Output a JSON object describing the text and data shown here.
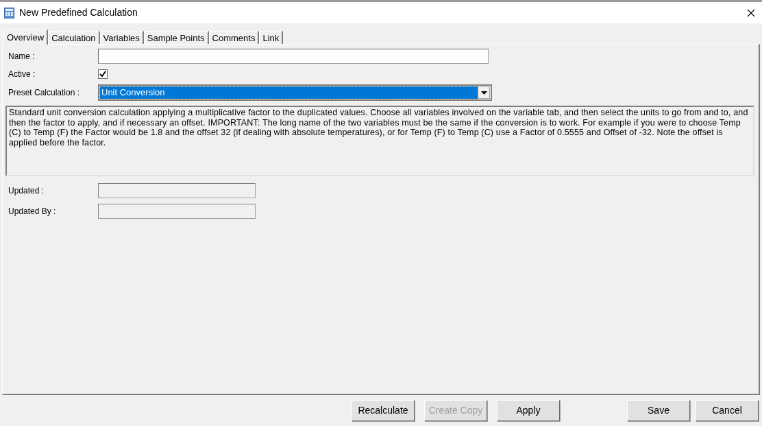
{
  "window": {
    "title": "New Predefined Calculation"
  },
  "tabs": [
    {
      "label": "Overview",
      "selected": true
    },
    {
      "label": "Calculation",
      "selected": false
    },
    {
      "label": "Variables",
      "selected": false
    },
    {
      "label": "Sample Points",
      "selected": false
    },
    {
      "label": "Comments",
      "selected": false
    },
    {
      "label": "Link",
      "selected": false
    }
  ],
  "form": {
    "name": {
      "label": "Name :"
    },
    "active": {
      "label": "Active :",
      "checked": true
    },
    "preset": {
      "label": "Preset Calculation :",
      "value": "Unit Conversion"
    },
    "description": "Standard unit conversion calculation applying a multiplicative factor to the duplicated values. Choose all variables involved on the variable tab, and then select the units to go from and to, and then the factor to apply, and if necessary an offset. IMPORTANT: The long name of the two variables must be the same if the conversion is to work. For example if you were to choose Temp (C) to Temp (F) the Factor would be 1.8 and the offset 32 (if dealing with absolute temperatures), or for Temp (F) to Temp (C) use a Factor of 0.5555 and Offset of -32. Note the offset is applied before the factor.",
    "updated": {
      "label": "Updated :"
    },
    "updated_by": {
      "label": "Updated By :"
    }
  },
  "buttons": [
    {
      "label": "Recalculate",
      "disabled": false
    },
    {
      "label": "Create Copy",
      "disabled": true
    },
    {
      "label": "Apply",
      "disabled": false
    }
  ],
  "dialog_buttons": [
    {
      "label": "Save",
      "disabled": false
    },
    {
      "label": "Cancel",
      "disabled": false
    }
  ]
}
